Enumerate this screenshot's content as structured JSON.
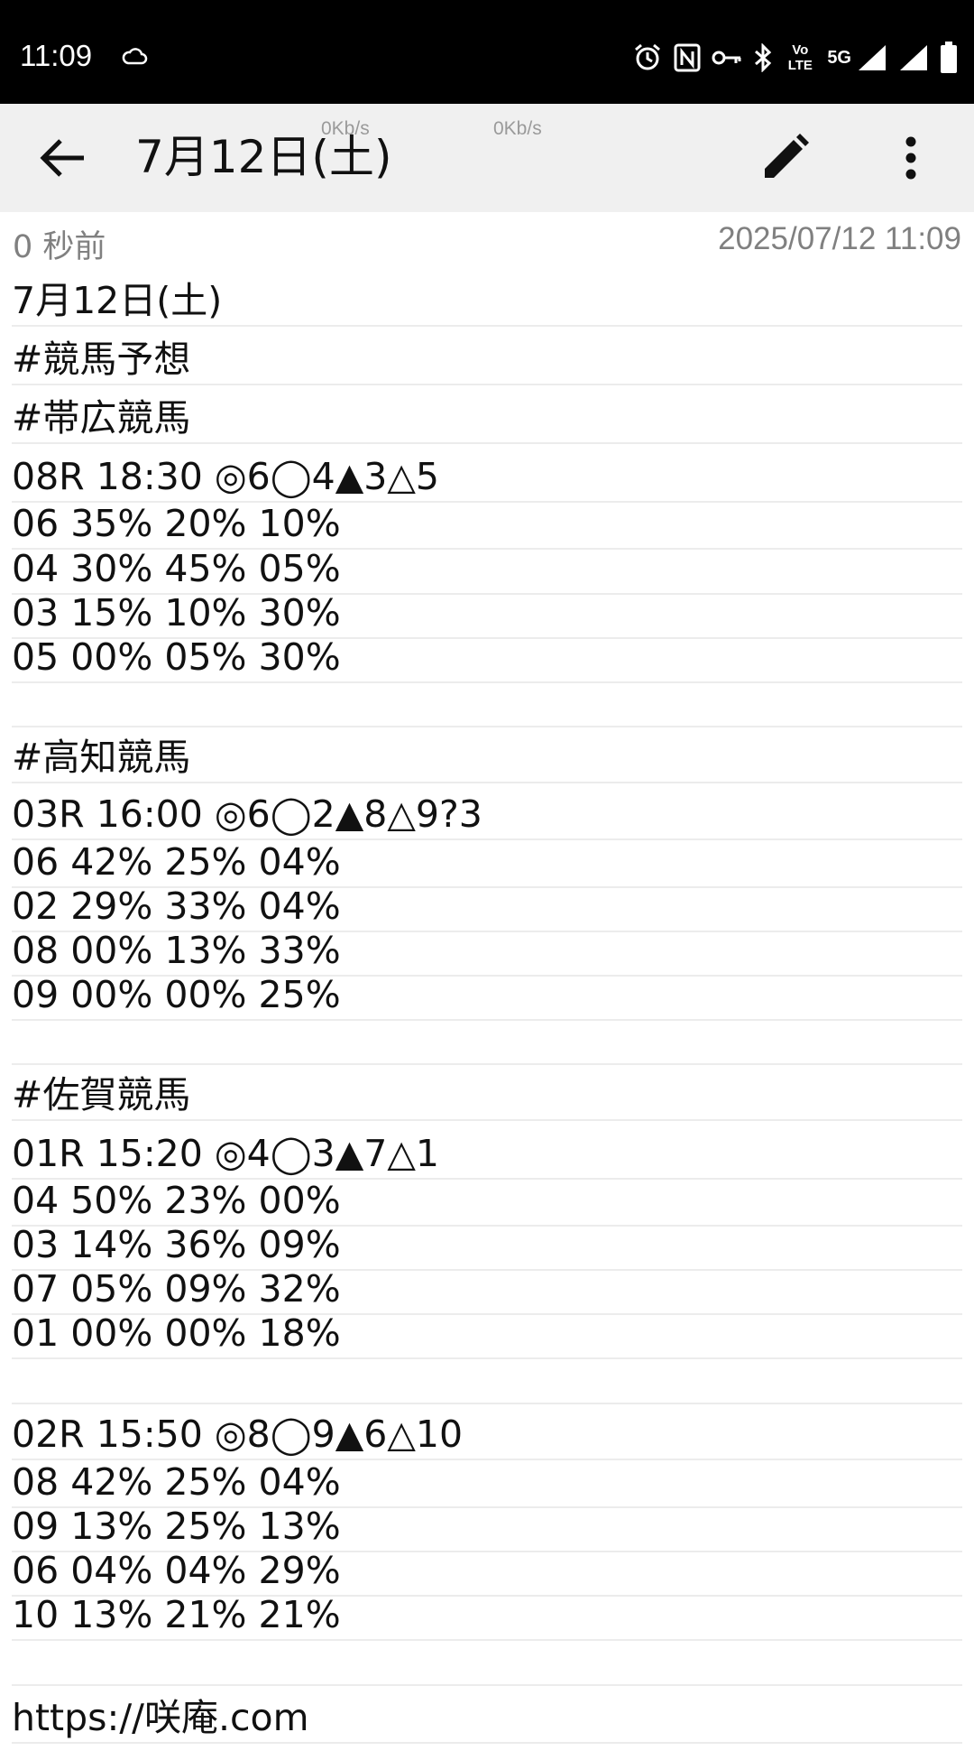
{
  "status_bar": {
    "time": "11:09",
    "network": "5G",
    "volte": "Vo LTE"
  },
  "app_bar": {
    "title": "7月12日(土)",
    "net_speed_1": "0Kb/s",
    "net_speed_2": "0Kb/s"
  },
  "meta": {
    "relative_time": "0 秒前",
    "timestamp": "2025/07/12 11:09"
  },
  "note_lines": [
    "7月12日(土)",
    "#競馬予想",
    "#帯広競馬",
    "08R 18:30 ◎6◯4▲3△5",
    "06 35% 20% 10%",
    "04 30% 45% 05%",
    "03 15% 10% 30%",
    "05 00% 05% 30%",
    "",
    "#高知競馬",
    "03R 16:00 ◎6◯2▲8△9?3",
    "06 42% 25% 04%",
    "02 29% 33% 04%",
    "08 00% 13% 33%",
    "09 00% 00% 25%",
    "",
    "#佐賀競馬",
    "01R 15:20 ◎4◯3▲7△1",
    "04 50% 23% 00%",
    "03 14% 36% 09%",
    "07 05% 09% 32%",
    "01 00% 00% 18%",
    "",
    "02R 15:50 ◎8◯9▲6△10",
    "08 42% 25% 04%",
    "09 13% 25% 13%",
    "06 04% 04% 29%",
    "10 13% 21% 21%",
    "",
    "https://咲庵.com"
  ]
}
